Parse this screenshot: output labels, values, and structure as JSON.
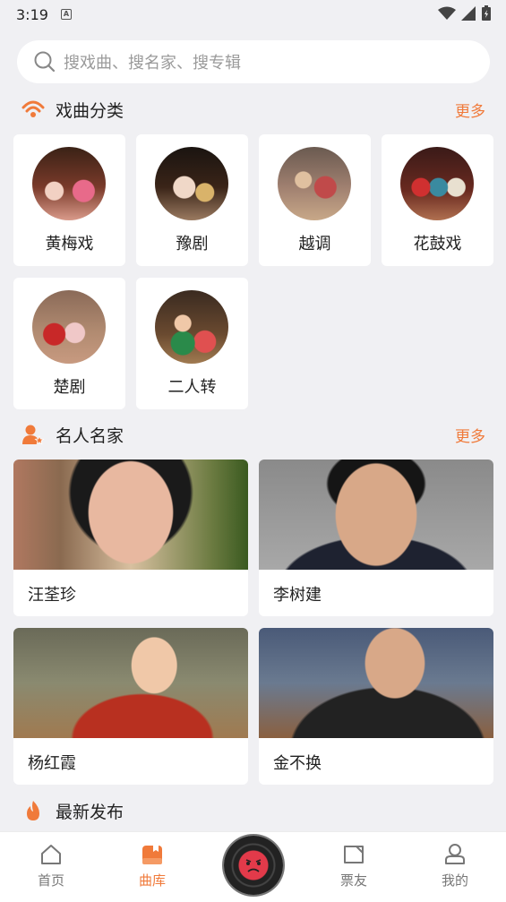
{
  "status_bar": {
    "time": "3:19",
    "badge": "A"
  },
  "search": {
    "placeholder": "搜戏曲、搜名家、搜专辑"
  },
  "opera_section": {
    "title": "戏曲分类",
    "more": "更多",
    "items": [
      {
        "label": "黄梅戏"
      },
      {
        "label": "豫剧"
      },
      {
        "label": "越调"
      },
      {
        "label": "花鼓戏"
      },
      {
        "label": "楚剧"
      },
      {
        "label": "二人转"
      }
    ]
  },
  "artists_section": {
    "title": "名人名家",
    "more": "更多",
    "items": [
      {
        "name": "汪荃珍"
      },
      {
        "name": "李树建"
      },
      {
        "name": "杨红霞"
      },
      {
        "name": "金不换"
      }
    ]
  },
  "latest_section": {
    "title": "最新发布"
  },
  "tabbar": {
    "items": [
      {
        "label": "首页",
        "icon": "home-icon"
      },
      {
        "label": "曲库",
        "icon": "library-icon",
        "active": true
      },
      {
        "label": "",
        "icon": "record-icon"
      },
      {
        "label": "票友",
        "icon": "fans-icon"
      },
      {
        "label": "我的",
        "icon": "profile-icon"
      }
    ]
  },
  "colors": {
    "accent": "#f07a3a",
    "background": "#f0f0f3"
  }
}
